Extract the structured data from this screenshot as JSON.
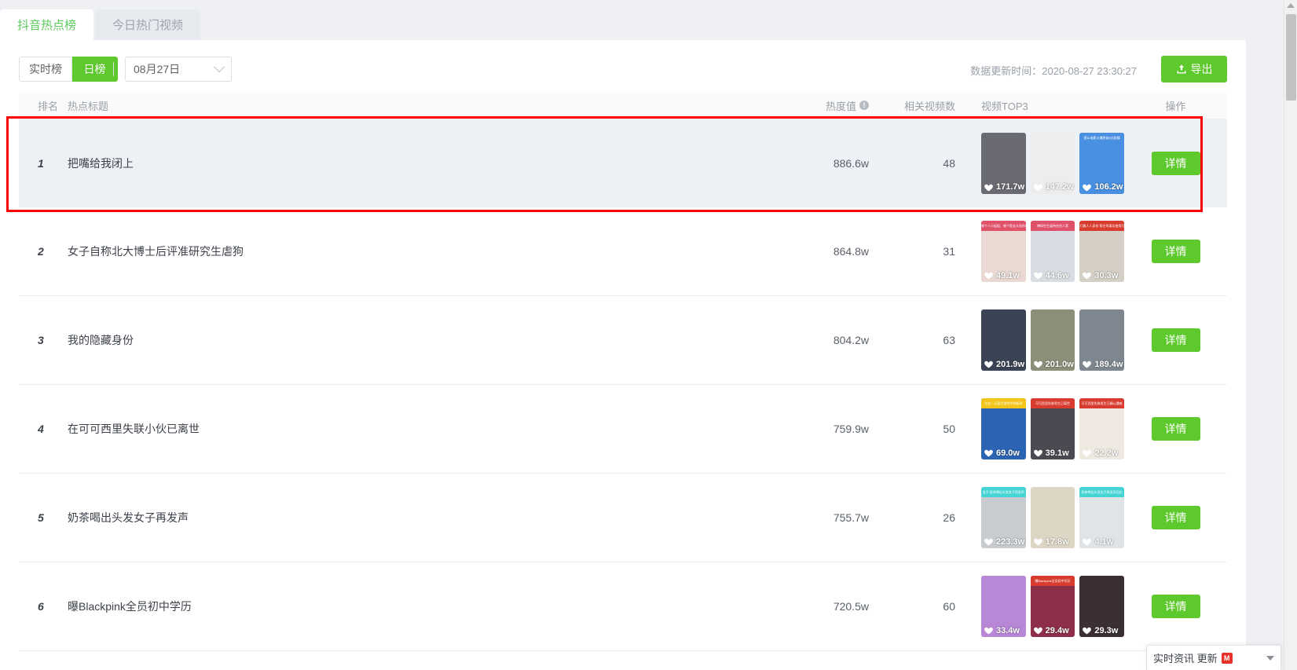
{
  "tabs": [
    {
      "label": "抖音热点榜",
      "active": true
    },
    {
      "label": "今日热门视频",
      "active": false
    }
  ],
  "toolbar": {
    "segment": [
      {
        "label": "实时榜",
        "active": false
      },
      {
        "label": "日榜",
        "active": true
      }
    ],
    "date_value": "08月27日",
    "updated_label": "数据更新时间：2020-08-27 23:30:27",
    "export_label": "导出",
    "export_icon": "upload-icon"
  },
  "table": {
    "headers": {
      "rank": "排名",
      "title": "热点标题",
      "heat": "热度值",
      "heat_info_icon": "info-icon",
      "count": "相关视频数",
      "top3": "视频TOP3",
      "action": "操作"
    },
    "detail_label": "详情",
    "rows": [
      {
        "rank": "1",
        "title": "把嘴给我闭上",
        "heat": "886.6w",
        "count": "48",
        "highlight": true,
        "thumbs": [
          {
            "likes": "171.7w",
            "bg": "#6a6a72",
            "banner": "",
            "banner_bg": "transparent"
          },
          {
            "likes": "147.2w",
            "bg": "#ededed",
            "banner": "",
            "banner_bg": "#000000"
          },
          {
            "likes": "106.2w",
            "bg": "#4a90e2",
            "banner": "甚么电影火爆原始5分剧情",
            "banner_bg": "#4a90e2"
          }
        ]
      },
      {
        "rank": "2",
        "title": "女子自称北大博士后评准研究生虐狗",
        "heat": "864.8w",
        "count": "31",
        "highlight": false,
        "thumbs": [
          {
            "likes": "49.1w",
            "bg": "#ead9d3",
            "banner": "哪个人小姐姐、哪个是长头发的哦",
            "banner_bg": "#e0516a"
          },
          {
            "likes": "44.6w",
            "bg": "#d9dce2",
            "banner": "博研究生虐待在别人家",
            "banner_bg": "#e0516a"
          },
          {
            "likes": "30.3w",
            "bg": "#d6cfc6",
            "banner": "打着人人身份 帮它举真实使用打包机器",
            "banner_bg": "#d83c2e"
          }
        ]
      },
      {
        "rank": "3",
        "title": "我的隐藏身份",
        "heat": "804.2w",
        "count": "63",
        "highlight": false,
        "thumbs": [
          {
            "likes": "201.9w",
            "bg": "#3a4454",
            "banner": "",
            "banner_bg": "transparent"
          },
          {
            "likes": "201.0w",
            "bg": "#8c8f7a",
            "banner": "",
            "banner_bg": "transparent"
          },
          {
            "likes": "189.4w",
            "bg": "#7e8790",
            "banner": "",
            "banner_bg": "transparent"
          }
        ]
      },
      {
        "rank": "4",
        "title": "在可可西里失联小伙已离世",
        "heat": "759.9w",
        "count": "50",
        "highlight": false,
        "thumbs": [
          {
            "likes": "69.0w",
            "bg": "#2c64b4",
            "banner": "在在一天离生里的中到新闻",
            "banner_bg": "#f3c51a"
          },
          {
            "likes": "39.1w",
            "bg": "#4a4a52",
            "banner": "可可西里失联男生已离世",
            "banner_bg": "#d83c2e"
          },
          {
            "likes": "22.2w",
            "bg": "#efe9e2",
            "banner": "可可西里失联男生已确认遇难",
            "banner_bg": "#d83c2e"
          }
        ]
      },
      {
        "rank": "5",
        "title": "奶茶喝出头发女子再发声",
        "heat": "755.7w",
        "count": "26",
        "highlight": false,
        "thumbs": [
          {
            "likes": "223.3w",
            "bg": "#c8ccd0",
            "banner": "女子 奶茶喝出头发女子再发声",
            "banner_bg": "#47d4d4"
          },
          {
            "likes": "17.8w",
            "bg": "#ded6c4",
            "banner": "",
            "banner_bg": "transparent"
          },
          {
            "likes": "4.1w",
            "bg": "#dfe4e6",
            "banner": "奶茶喝出头发女子再发声回应",
            "banner_bg": "#47d4d4"
          }
        ]
      },
      {
        "rank": "6",
        "title": "曝Blackpink全员初中学历",
        "heat": "720.5w",
        "count": "60",
        "highlight": false,
        "thumbs": [
          {
            "likes": "33.4w",
            "bg": "#b887d6",
            "banner": "",
            "banner_bg": "transparent"
          },
          {
            "likes": "29.4w",
            "bg": "#8d2f4a",
            "banner": "曝Blackpink全员初中学历",
            "banner_bg": "#d83c2e"
          },
          {
            "likes": "29.3w",
            "bg": "#3b2f33",
            "banner": "",
            "banner_bg": "transparent"
          }
        ]
      }
    ]
  },
  "float_widget": {
    "text": "实时资讯 更新",
    "badge": "M",
    "chevron_icon": "chevron-down-icon"
  },
  "colors": {
    "accent_green": "#5ec92c",
    "highlight_row": "#edf0f5",
    "redbox": "#ff0000"
  }
}
